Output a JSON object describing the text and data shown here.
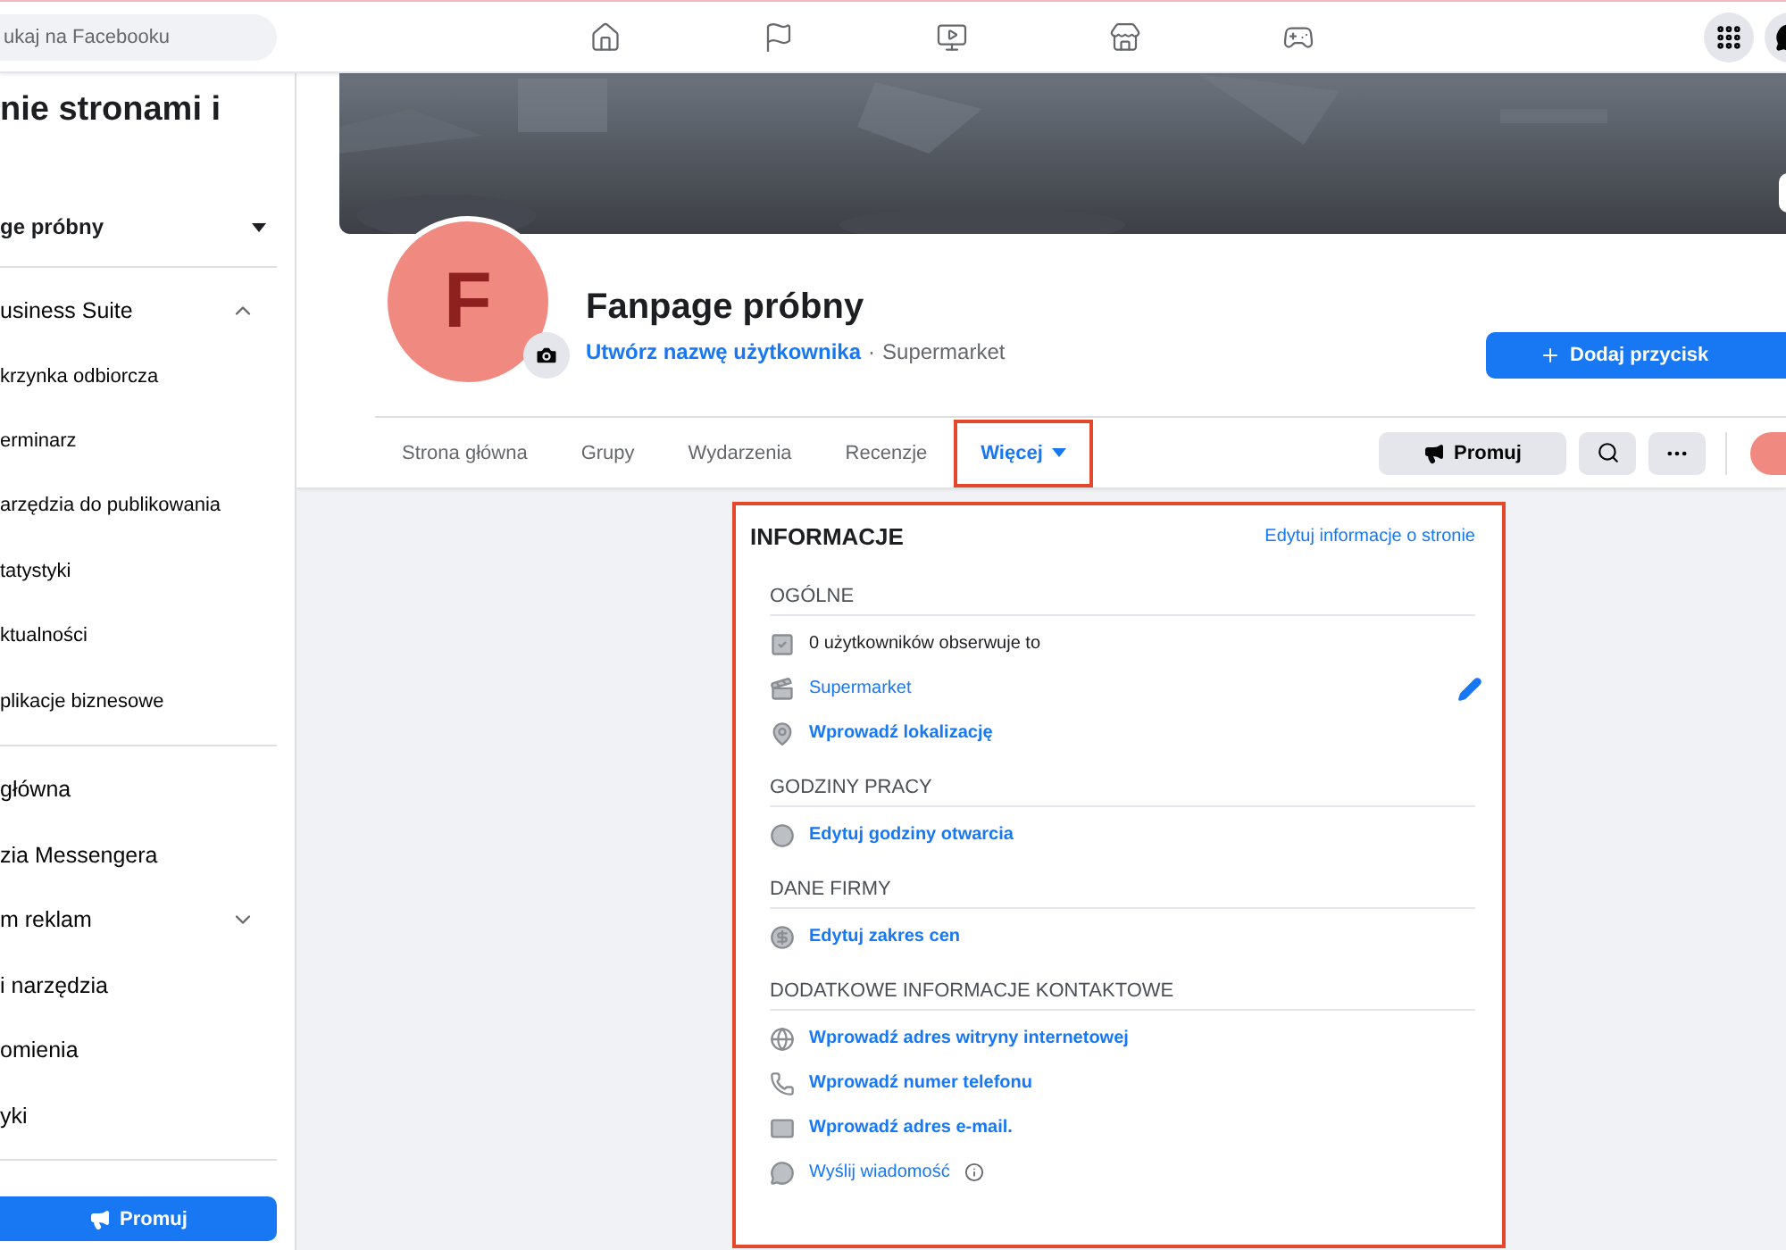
{
  "top_bar": {
    "search": {
      "placeholder": "ukaj na Facebooku"
    },
    "nav_icons": [
      {
        "kind": "home"
      },
      {
        "kind": "flag"
      },
      {
        "kind": "video"
      },
      {
        "kind": "store"
      },
      {
        "kind": "game"
      }
    ],
    "right_icons": [
      {
        "kind": "grid"
      },
      {
        "kind": "messenger"
      }
    ]
  },
  "sidebar": {
    "title": "nie stronami i",
    "page_selector": "ge próbny",
    "sections": [
      {
        "items": [
          {
            "label": "usiness Suite",
            "expanded": true,
            "children": [
              {
                "label": "krzynka odbiorcza"
              },
              {
                "label": "erminarz"
              },
              {
                "label": "arzędzia do publikowania"
              },
              {
                "label": "tatystyki"
              },
              {
                "label": "ktualności"
              },
              {
                "label": "plikacje biznesowe"
              }
            ]
          }
        ]
      },
      {
        "items": [
          {
            "label": "główna"
          },
          {
            "label": "zia Messengera"
          },
          {
            "label": "m reklam",
            "expanded": false
          },
          {
            "label": "i narzędzia"
          },
          {
            "label": "omienia"
          },
          {
            "label": "yki"
          }
        ]
      }
    ],
    "promote_button": "Promuj"
  },
  "profile": {
    "initial": "F",
    "name": "Fanpage próbny",
    "username_link": "Utwórz nazwę użytkownika",
    "separator": "·",
    "category": "Supermarket",
    "add_button": "Dodaj przycisk",
    "tabs": [
      {
        "label": "Strona główna",
        "selected": false,
        "highlighted": false
      },
      {
        "label": "Grupy",
        "selected": false,
        "highlighted": false
      },
      {
        "label": "Wydarzenia",
        "selected": false,
        "highlighted": false
      },
      {
        "label": "Recenzje",
        "selected": false,
        "highlighted": false
      },
      {
        "label": "Więcej",
        "selected": true,
        "highlighted": true,
        "dropdown": true
      }
    ],
    "promote_button": "Promuj"
  },
  "info_card": {
    "title": "INFORMACJE",
    "edit_link": "Edytuj informacje o stronie",
    "highlighted": true,
    "sections": [
      {
        "heading": "OGÓLNE",
        "rows": [
          {
            "kind": "text",
            "text": "0 użytkowników obserwuje to"
          },
          {
            "kind": "link",
            "text": "Supermarket",
            "editable": true
          },
          {
            "kind": "action",
            "text": "Wprowadź lokalizację"
          }
        ]
      },
      {
        "heading": "GODZINY PRACY",
        "rows": [
          {
            "kind": "action",
            "text": "Edytuj godziny otwarcia"
          }
        ]
      },
      {
        "heading": "DANE FIRMY",
        "rows": [
          {
            "kind": "action",
            "text": "Edytuj zakres cen"
          }
        ]
      },
      {
        "heading": "DODATKOWE INFORMACJE KONTAKTOWE",
        "rows": [
          {
            "kind": "action",
            "text": "Wprowadź adres witryny internetowej"
          },
          {
            "kind": "action",
            "text": "Wprowadź numer telefonu"
          },
          {
            "kind": "action",
            "text": "Wprowadź adres e-mail."
          },
          {
            "kind": "link",
            "text": "Wyślij wiadomość",
            "info": true
          }
        ]
      }
    ]
  }
}
